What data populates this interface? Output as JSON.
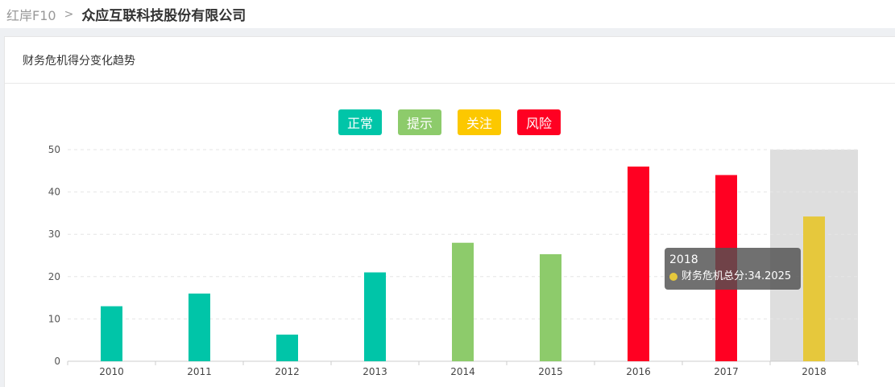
{
  "breadcrumb": {
    "root": "红岸F10",
    "separator": ">",
    "current": "众应互联科技股份有限公司"
  },
  "panel": {
    "title": "财务危机得分变化趋势"
  },
  "legend": [
    {
      "label": "正常",
      "color": "#00c5a8"
    },
    {
      "label": "提示",
      "color": "#8dcb6b"
    },
    {
      "label": "关注",
      "color": "#fcc800"
    },
    {
      "label": "风险",
      "color": "#ff0022"
    }
  ],
  "tooltip": {
    "title": "2018",
    "series_label": "财务危机总分",
    "value_text": "34.2025"
  },
  "chart_data": {
    "type": "bar",
    "categories": [
      "2010",
      "2011",
      "2012",
      "2013",
      "2014",
      "2015",
      "2016",
      "2017",
      "2018"
    ],
    "series": [
      {
        "name": "财务危机总分",
        "values": [
          13,
          16,
          6.3,
          21,
          28,
          25.3,
          46,
          44,
          34.2025
        ]
      }
    ],
    "bar_colors": [
      "#00c5a8",
      "#00c5a8",
      "#00c5a8",
      "#00c5a8",
      "#8dcb6b",
      "#8dcb6b",
      "#ff0022",
      "#ff0022",
      "#e6c83c"
    ],
    "highlighted_category": "2018",
    "highlight_color": "#dedede",
    "ylim": [
      0,
      50
    ],
    "yticks": [
      0,
      10,
      20,
      30,
      40,
      50
    ],
    "grid": true
  }
}
